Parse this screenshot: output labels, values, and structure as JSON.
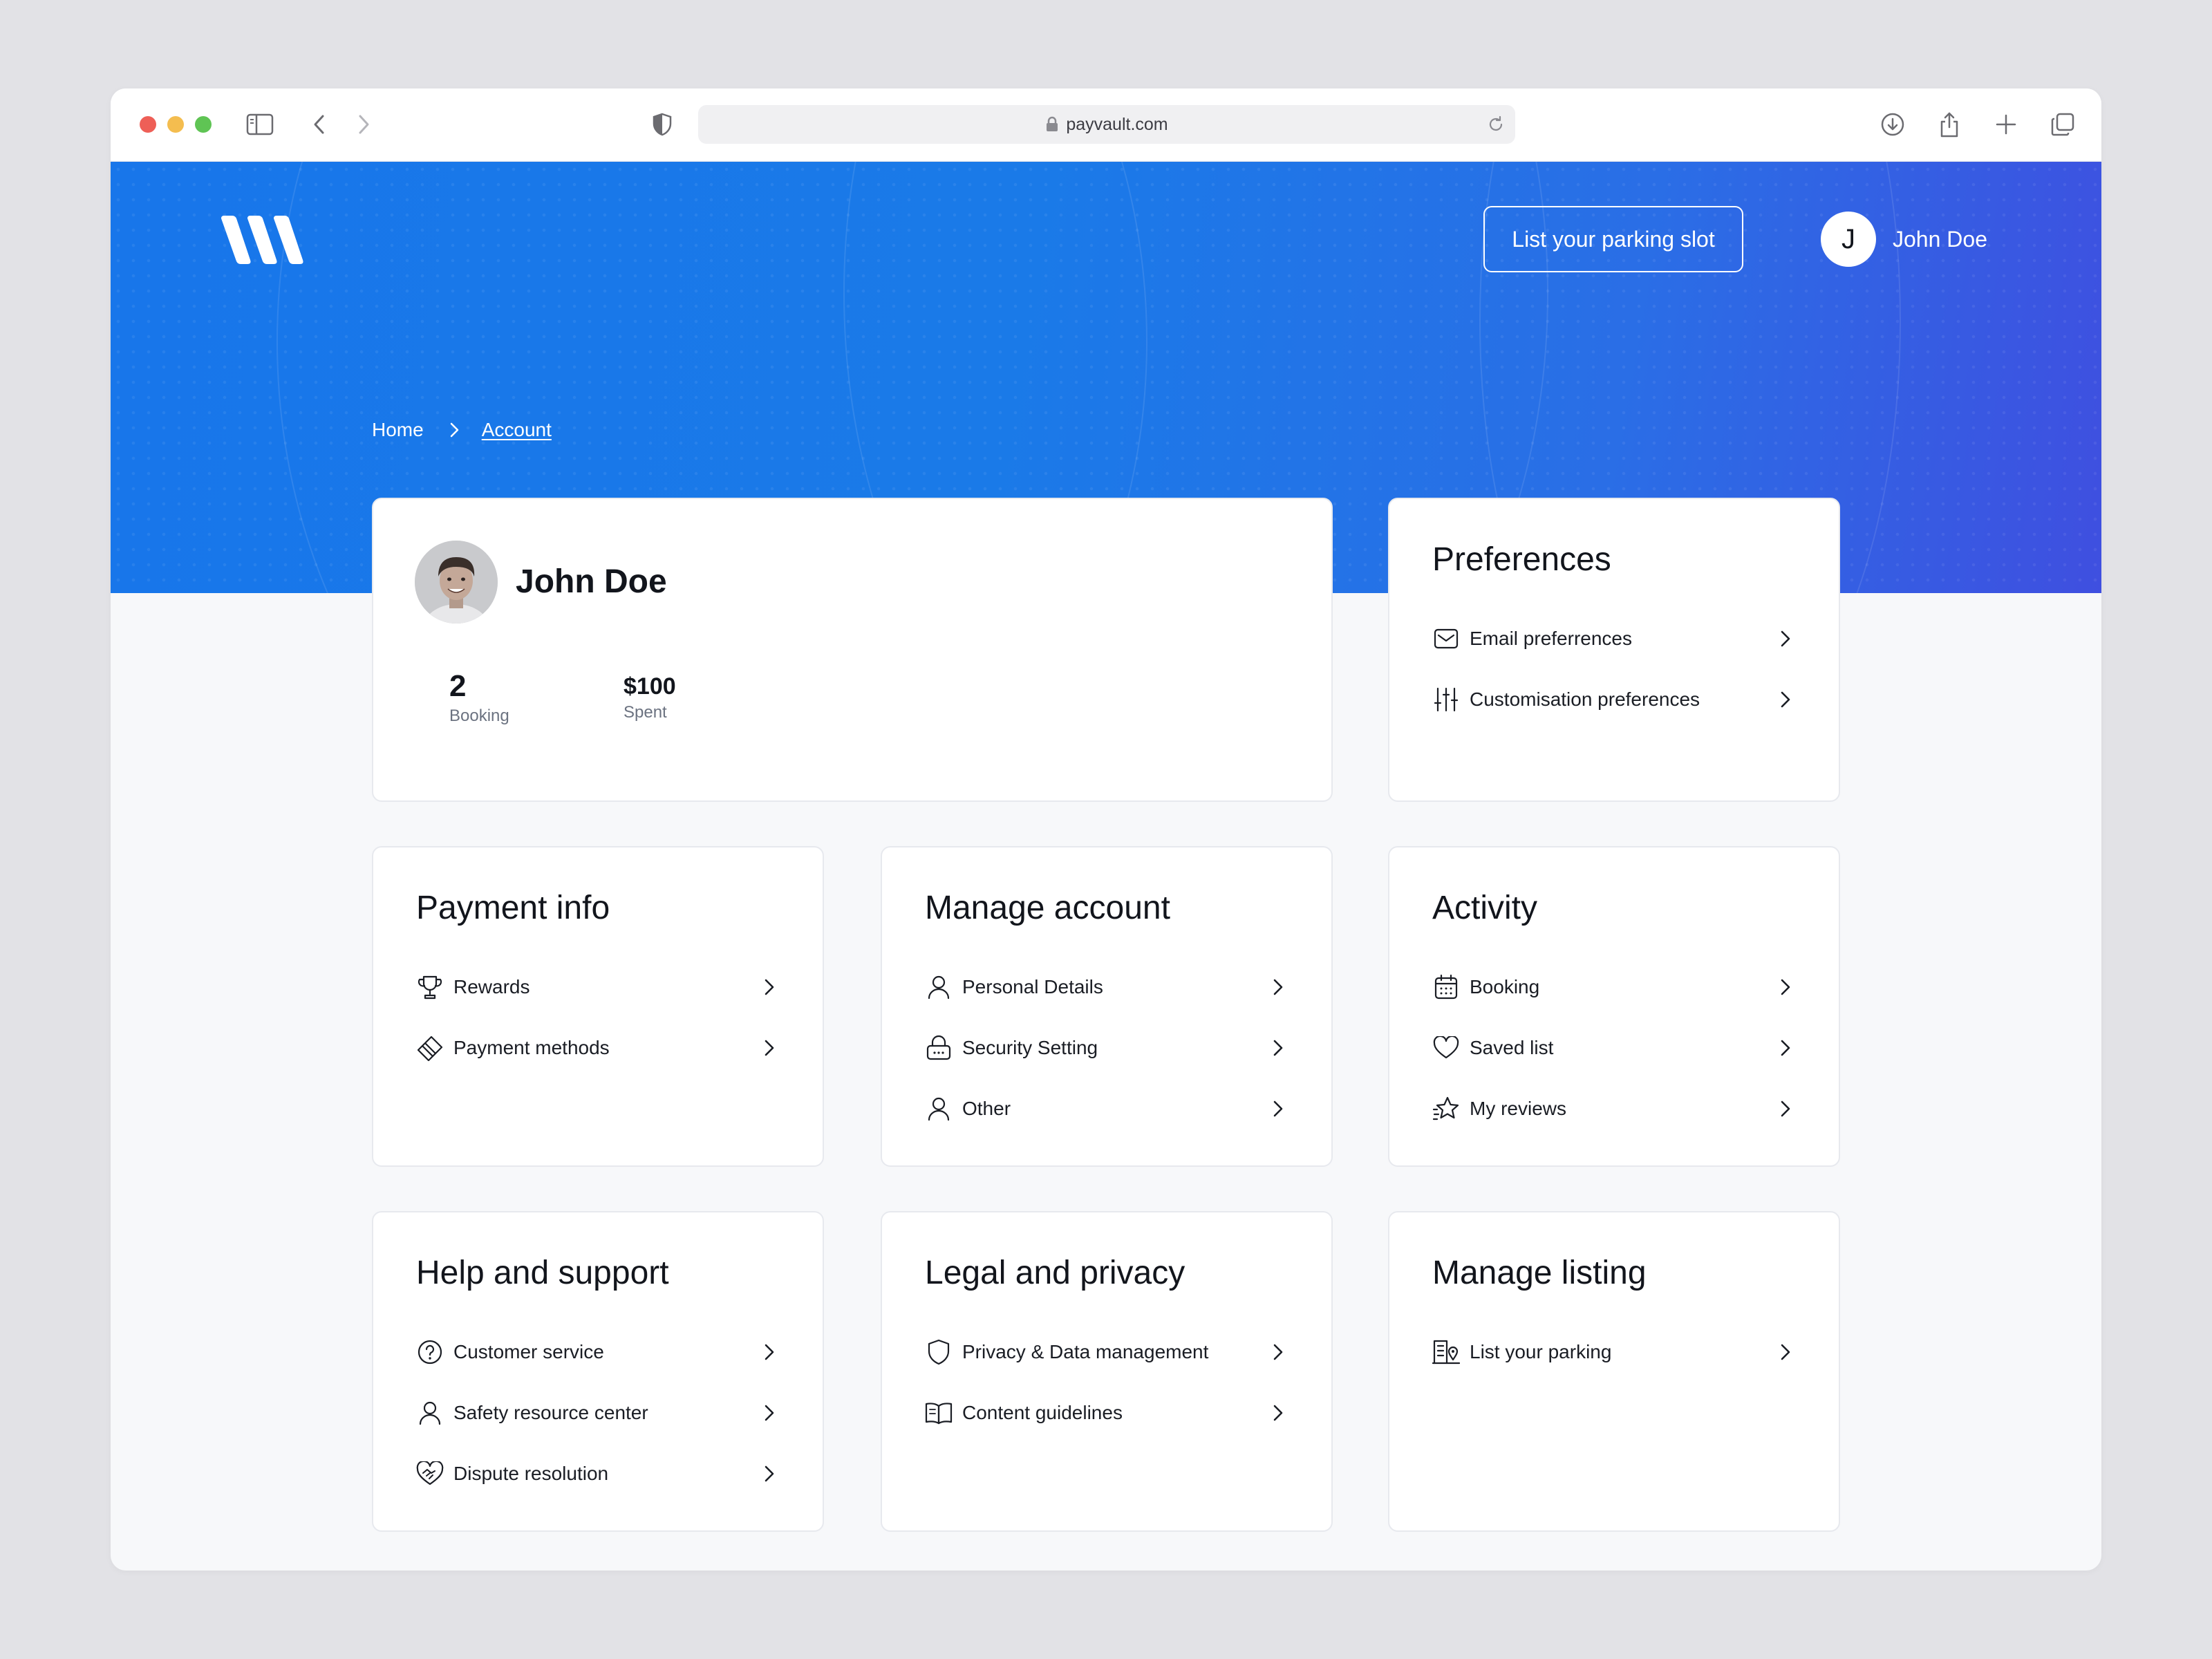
{
  "browser": {
    "url": "payvault.com"
  },
  "header": {
    "list_slot_label": "List your parking slot",
    "user_initial": "J",
    "user_name": "John Doe"
  },
  "breadcrumb": {
    "home": "Home",
    "current": "Account"
  },
  "profile": {
    "name": "John Doe",
    "bookings_value": "2",
    "bookings_label": "Booking",
    "spent_value": "$100",
    "spent_label": "Spent"
  },
  "preferences": {
    "title": "Preferences",
    "items": [
      {
        "label": "Email preferrences",
        "icon": "mail-icon"
      },
      {
        "label": "Customisation preferences",
        "icon": "sliders-icon"
      }
    ]
  },
  "payment_info": {
    "title": "Payment info",
    "items": [
      {
        "label": "Rewards",
        "icon": "trophy-icon"
      },
      {
        "label": "Payment methods",
        "icon": "card-icon"
      }
    ]
  },
  "manage_account": {
    "title": "Manage account",
    "items": [
      {
        "label": "Personal Details",
        "icon": "user-icon"
      },
      {
        "label": "Security Setting",
        "icon": "lock-icon"
      },
      {
        "label": "Other",
        "icon": "user-icon"
      }
    ]
  },
  "activity": {
    "title": "Activity",
    "items": [
      {
        "label": "Booking",
        "icon": "calendar-icon"
      },
      {
        "label": "Saved list",
        "icon": "heart-icon"
      },
      {
        "label": "My reviews",
        "icon": "star-icon"
      }
    ]
  },
  "help_support": {
    "title": "Help and support",
    "items": [
      {
        "label": "Customer service",
        "icon": "question-icon"
      },
      {
        "label": "Safety resource center",
        "icon": "user-icon"
      },
      {
        "label": "Dispute resolution",
        "icon": "handshake-heart-icon"
      }
    ]
  },
  "legal_privacy": {
    "title": "Legal and privacy",
    "items": [
      {
        "label": "Privacy & Data management",
        "icon": "shield-icon"
      },
      {
        "label": "Content guidelines",
        "icon": "book-icon"
      }
    ]
  },
  "manage_listing": {
    "title": "Manage listing",
    "items": [
      {
        "label": "List your parking",
        "icon": "building-pin-icon"
      }
    ]
  },
  "colors": {
    "hero_start": "#1876ea",
    "hero_end": "#3f4fe0",
    "page_bg": "#f7f8fa",
    "card_border": "#e7e9ee"
  }
}
